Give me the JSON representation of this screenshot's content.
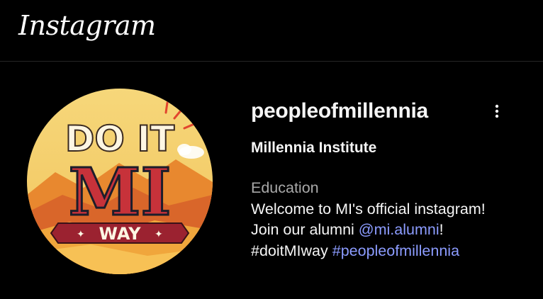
{
  "header": {
    "logo_text": "Instagram"
  },
  "profile": {
    "avatar": {
      "top_text": "DO IT",
      "middle_text": "MI",
      "banner_text": "WAY"
    },
    "username": "peopleofmillennia",
    "more_options_icon": "more-vertical-icon",
    "full_name": "Millennia Institute",
    "category": "Education",
    "bio": {
      "line1": "Welcome to MI's official instagram!",
      "line2_prefix": "Join our alumni ",
      "line2_mention": "@mi.alumni",
      "line2_suffix": "!",
      "line3_hashtag1": "#doitMIway",
      "line3_space": " ",
      "line3_hashtag2": "#peopleofmillennia"
    }
  },
  "colors": {
    "background": "#000000",
    "text_primary": "#f5f5f5",
    "text_secondary": "#a8a8a8",
    "link": "#8c9cff",
    "divider": "#262626"
  }
}
